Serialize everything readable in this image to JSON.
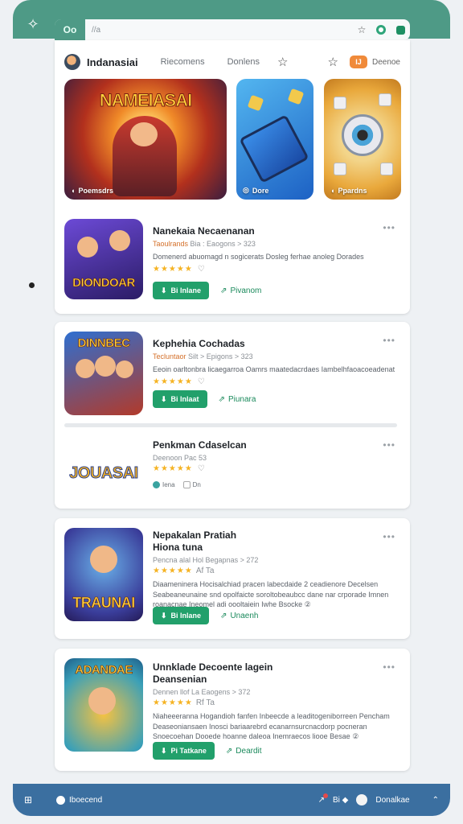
{
  "browser": {
    "tab_label": "Oo",
    "address": "//a",
    "star_icon": "star-icon",
    "accent": "#4e9a86"
  },
  "nav": {
    "brand": "Indanasiai",
    "links": [
      "Riecomens",
      "Donlens"
    ],
    "badge": "IJ",
    "more": "Deenoe"
  },
  "hero": [
    {
      "title": "NAMEIASAI",
      "caption": "Poemsdrs"
    },
    {
      "caption": "Dore"
    },
    {
      "caption": "Ppardns"
    }
  ],
  "items": [
    {
      "name": "Nanekaia Necaenanan",
      "meta_hl": "Taoulrands",
      "meta": "Bia : Eaogons > 323",
      "desc": "Domenerd abuomagd n sogicerats Dosleg ferhae anoleg Dorades",
      "stars": "★★★★★",
      "thumb_label": "DIONDOAR",
      "primary": "Bi Inlane",
      "secondary": "Pivanom"
    },
    {
      "name": "Kephehia Cochadas",
      "meta_hl": "Tecluntaor",
      "meta": "Silt > Epigons > 323",
      "desc": "Eeoin oarltonbra licaegarroa Oamrs maatedacrdaes Iambelhfaoacoeadenat",
      "stars": "★★★★★",
      "thumb_label": "DINNBEC",
      "primary": "Bi Inlaat",
      "secondary": "Piunara"
    },
    {
      "name": "Penkman Cdaselcan",
      "meta": "Deenoon Pac 53",
      "stars": "★★★★★",
      "thumb_label": "JOUASAI",
      "tags": [
        "Iena",
        "Dn"
      ]
    },
    {
      "name": "Nepakalan Pratiah",
      "name2": "Hiona tuna",
      "meta": "Pencna alal Hol Begapnas > 272",
      "desc": "Diaameninera Hocisalchiad pracen labecdaide 2 ceadienore Decelsen Seabeaneunaine snd opolfaicte soroltobeaubcc dane nar crporade Imnen roanacnae Ineomel adi oooltaiein Iwhe Bsocke ②",
      "stars": "★★★★★",
      "rating_text": "Af Ta",
      "thumb_label": "TRAUNAI",
      "primary": "Bi Inlane",
      "secondary": "Unaenh"
    },
    {
      "name": "Unnklade Decoente lagein",
      "name2": "Deansenian",
      "meta": "Dennen llof La Eaogens > 372",
      "desc": "Niaheeeranna Hogandioh fanfen Inbeecde a leaditogeniborreen Pencham Deaseoniansaen Inosci bariaarebrd ecanarnsurcnacdorp pocneran Snoecoehan Dooede hoanne daleoa Inemraecos liooe Besae ②",
      "stars": "★★★★★",
      "rating_text": "Rf Ta",
      "thumb_label": "ADANDAE",
      "primary": "Pi Tatkane",
      "secondary": "Deardit"
    }
  ],
  "bottom": {
    "home_label": "Iboecend",
    "right_label": "Donalkae",
    "bell_count": "",
    "mid_label": "Bi ◆"
  }
}
